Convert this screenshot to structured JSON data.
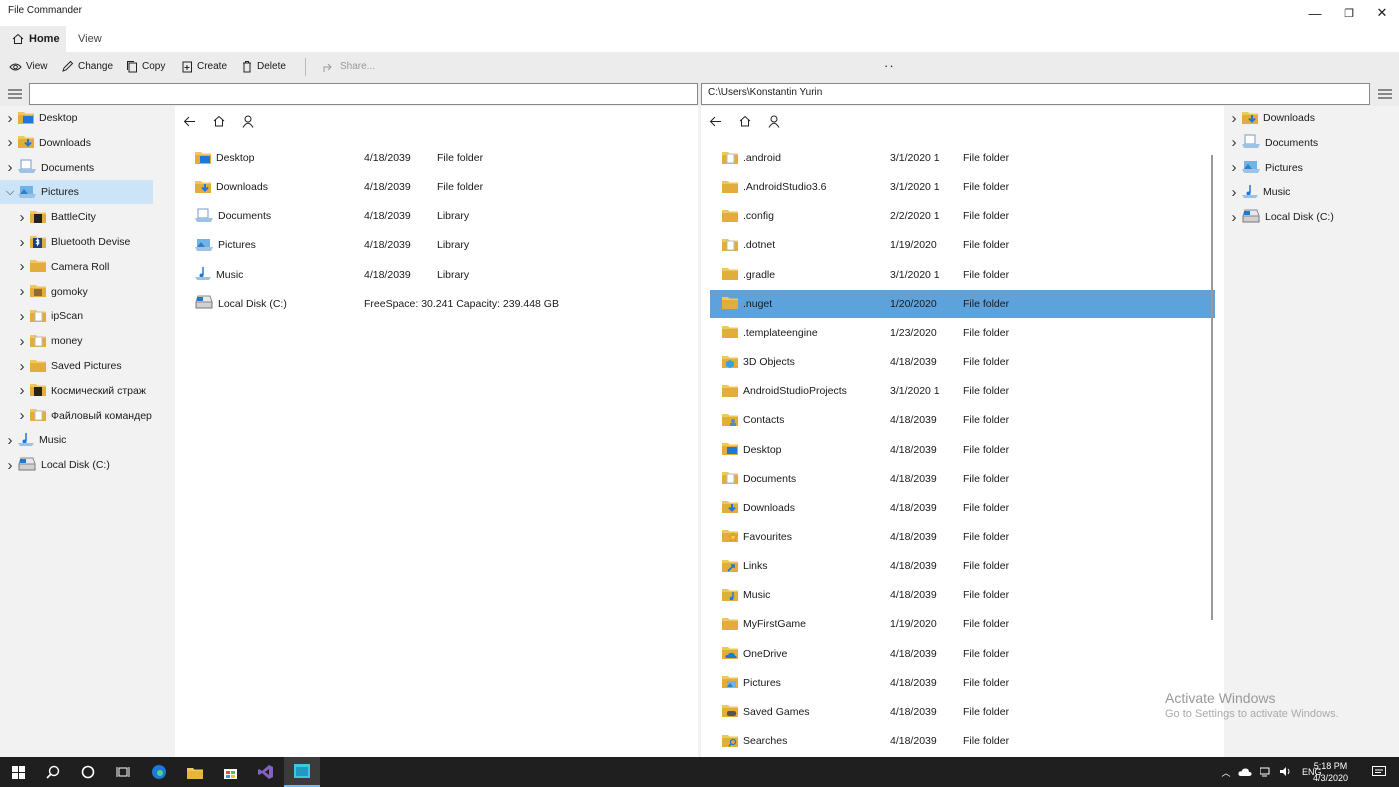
{
  "window": {
    "title": "File Commander",
    "minimize": "—",
    "restore": "❐",
    "close": "✕"
  },
  "tabs": [
    {
      "label": "Home"
    },
    {
      "label": "View"
    }
  ],
  "toolbar": [
    {
      "label": "View",
      "icon": "eye-icon"
    },
    {
      "label": "Change",
      "icon": "pencil-icon"
    },
    {
      "label": "Copy",
      "icon": "copy-icon"
    },
    {
      "label": "Create",
      "icon": "create-icon"
    },
    {
      "label": "Delete",
      "icon": "trash-icon"
    },
    {
      "label": "Share...",
      "icon": "share-icon"
    }
  ],
  "toolbar_more": "··",
  "left_address": "",
  "right_address": "C:\\Users\\Konstantin Yurin",
  "left_tree": [
    {
      "label": "Desktop",
      "icon": "desktop-folder"
    },
    {
      "label": "Downloads",
      "icon": "downloads-folder"
    },
    {
      "label": "Documents",
      "icon": "documents-library"
    },
    {
      "label": "Pictures",
      "icon": "pictures-library",
      "selected": true,
      "expanded": true
    },
    {
      "label": "BattleCity",
      "icon": "folder-dark",
      "child": true
    },
    {
      "label": "Bluetooth Devise",
      "icon": "folder-bluetooth",
      "child": true
    },
    {
      "label": "Camera Roll",
      "icon": "folder",
      "child": true
    },
    {
      "label": "gomoky",
      "icon": "folder-image",
      "child": true
    },
    {
      "label": "ipScan",
      "icon": "folder-doc",
      "child": true
    },
    {
      "label": "money",
      "icon": "folder-doc",
      "child": true
    },
    {
      "label": "Saved Pictures",
      "icon": "folder",
      "child": true
    },
    {
      "label": "Космический страж",
      "icon": "folder-dark",
      "child": true
    },
    {
      "label": "Файловый командер",
      "icon": "folder-doc",
      "child": true
    },
    {
      "label": "Music",
      "icon": "music-library"
    },
    {
      "label": "Local Disk (C:)",
      "icon": "disk-icon"
    }
  ],
  "left_files": [
    {
      "name": "Desktop",
      "date": "4/18/2039",
      "type": "File folder",
      "icon": "desktop-folder"
    },
    {
      "name": "Downloads",
      "date": "4/18/2039",
      "type": "File folder",
      "icon": "downloads-folder"
    },
    {
      "name": "Documents",
      "date": "4/18/2039",
      "type": "Library",
      "icon": "documents-library"
    },
    {
      "name": "Pictures",
      "date": "4/18/2039",
      "type": "Library",
      "icon": "pictures-library"
    },
    {
      "name": "Music",
      "date": "4/18/2039",
      "type": "Library",
      "icon": "music-library"
    },
    {
      "name": "Local Disk (C:)",
      "date": "FreeSpace: 30.241  Capacity:  239.448 GB",
      "type": "",
      "icon": "disk-icon"
    }
  ],
  "right_files": [
    {
      "name": ".android",
      "date": "3/1/2020 1",
      "type": "File folder",
      "icon": "folder-doc"
    },
    {
      "name": ".AndroidStudio3.6",
      "date": "3/1/2020 1",
      "type": "File folder",
      "icon": "folder"
    },
    {
      "name": ".config",
      "date": "2/2/2020 1",
      "type": "File folder",
      "icon": "folder"
    },
    {
      "name": ".dotnet",
      "date": "1/19/2020",
      "type": "File folder",
      "icon": "folder-doc"
    },
    {
      "name": ".gradle",
      "date": "3/1/2020 1",
      "type": "File folder",
      "icon": "folder"
    },
    {
      "name": ".nuget",
      "date": "1/20/2020",
      "type": "File folder",
      "icon": "folder",
      "selected": true
    },
    {
      "name": ".templateengine",
      "date": "1/23/2020",
      "type": "File folder",
      "icon": "folder"
    },
    {
      "name": "3D Objects",
      "date": "4/18/2039",
      "type": "File folder",
      "icon": "folder-3d"
    },
    {
      "name": "AndroidStudioProjects",
      "date": "3/1/2020 1",
      "type": "File folder",
      "icon": "folder"
    },
    {
      "name": "Contacts",
      "date": "4/18/2039",
      "type": "File folder",
      "icon": "folder-contacts"
    },
    {
      "name": "Desktop",
      "date": "4/18/2039",
      "type": "File folder",
      "icon": "desktop-folder"
    },
    {
      "name": "Documents",
      "date": "4/18/2039",
      "type": "File folder",
      "icon": "folder-doc"
    },
    {
      "name": "Downloads",
      "date": "4/18/2039",
      "type": "File folder",
      "icon": "downloads-folder"
    },
    {
      "name": "Favourites",
      "date": "4/18/2039",
      "type": "File folder",
      "icon": "folder-star"
    },
    {
      "name": "Links",
      "date": "4/18/2039",
      "type": "File folder",
      "icon": "folder-link"
    },
    {
      "name": "Music",
      "date": "4/18/2039",
      "type": "File folder",
      "icon": "folder-music"
    },
    {
      "name": "MyFirstGame",
      "date": "1/19/2020",
      "type": "File folder",
      "icon": "folder"
    },
    {
      "name": "OneDrive",
      "date": "4/18/2039",
      "type": "File folder",
      "icon": "onedrive-folder"
    },
    {
      "name": "Pictures",
      "date": "4/18/2039",
      "type": "File folder",
      "icon": "folder-pictures"
    },
    {
      "name": "Saved Games",
      "date": "4/18/2039",
      "type": "File folder",
      "icon": "folder-games"
    },
    {
      "name": "Searches",
      "date": "4/18/2039",
      "type": "File folder",
      "icon": "folder-search"
    }
  ],
  "right_tree": [
    {
      "label": "Downloads",
      "icon": "downloads-folder"
    },
    {
      "label": "Documents",
      "icon": "documents-library"
    },
    {
      "label": "Pictures",
      "icon": "pictures-library"
    },
    {
      "label": "Music",
      "icon": "music-library"
    },
    {
      "label": "Local Disk (C:)",
      "icon": "disk-icon"
    }
  ],
  "watermark": {
    "title": "Activate Windows",
    "subtitle": "Go to Settings to activate Windows."
  },
  "taskbar": {
    "lang": "ENG",
    "time": "5:18 PM",
    "date": "4/3/2020"
  },
  "colors": {
    "selection": "#5ea2db",
    "tree_selection": "#cce4f7",
    "folder": "#f0c75e",
    "accent": "#1e78d7",
    "taskbar": "#1f1f1f"
  }
}
